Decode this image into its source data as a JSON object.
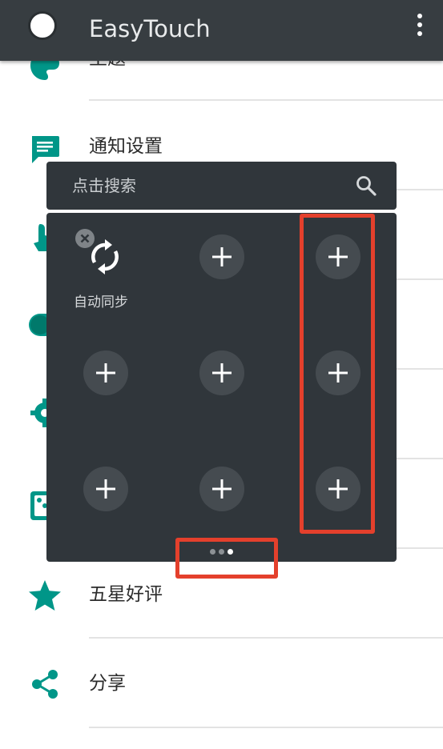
{
  "app_bar": {
    "title": "EasyTouch",
    "menu_icon": "more-vert-icon"
  },
  "settings_list": {
    "items": [
      {
        "label": "主题",
        "icon": "palette-icon"
      },
      {
        "label": "通知设置",
        "icon": "message-icon"
      },
      {
        "label": "",
        "icon": "touch-icon"
      },
      {
        "label": "",
        "icon": "toggle-icon"
      },
      {
        "label": "",
        "icon": "gear-icon"
      },
      {
        "label": "",
        "icon": "dice-icon"
      },
      {
        "label": "五星好评",
        "icon": "star-icon"
      },
      {
        "label": "分享",
        "icon": "share-icon"
      }
    ]
  },
  "search": {
    "placeholder": "点击搜索",
    "icon": "search-icon"
  },
  "panel": {
    "slots": [
      {
        "label": "自动同步",
        "icon": "sync-icon",
        "removable": true
      },
      {
        "label": "",
        "icon": "add-icon"
      },
      {
        "label": "",
        "icon": "add-icon"
      },
      {
        "label": "",
        "icon": "add-icon"
      },
      {
        "label": "",
        "icon": "add-icon"
      },
      {
        "label": "",
        "icon": "add-icon"
      },
      {
        "label": "",
        "icon": "add-icon"
      },
      {
        "label": "",
        "icon": "add-icon"
      },
      {
        "label": "",
        "icon": "add-icon"
      }
    ],
    "pages": 3,
    "current_page": 3
  },
  "colors": {
    "accent_teal": "#009688",
    "app_bar": "#373d41",
    "panel": "#30363b",
    "highlight": "#e4402c"
  }
}
